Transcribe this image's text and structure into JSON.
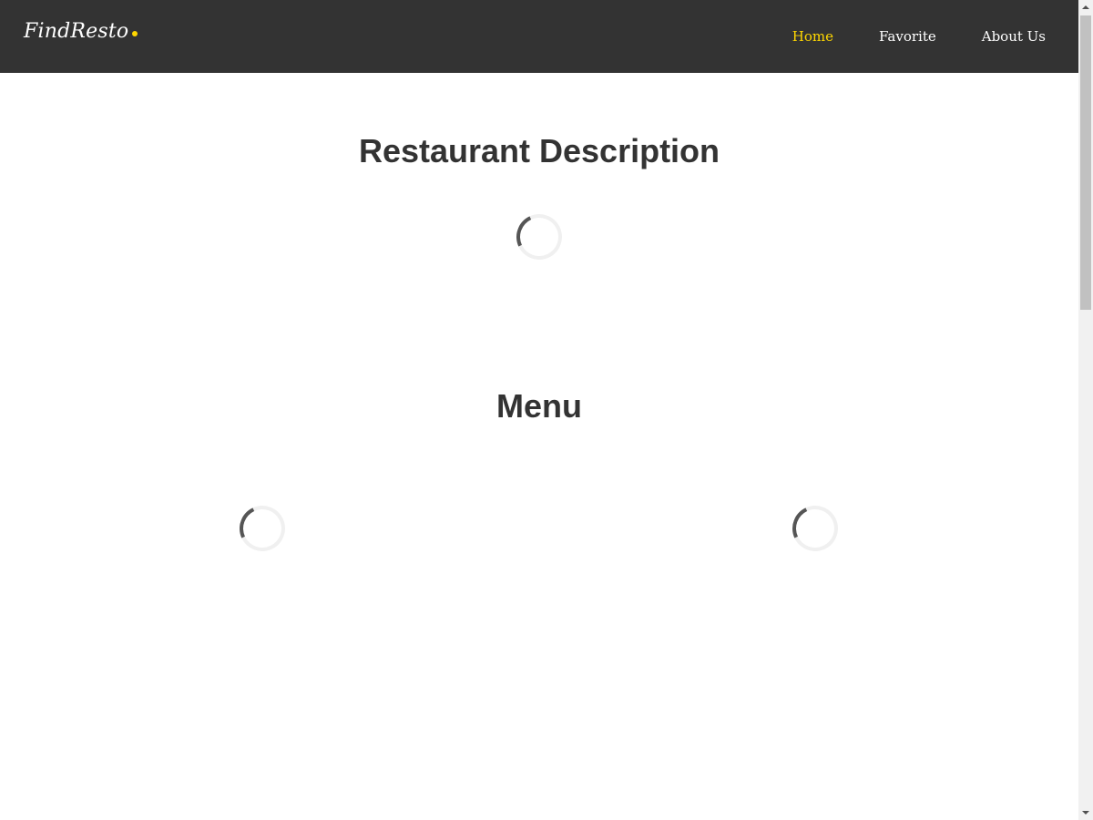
{
  "header": {
    "brand": "FindResto",
    "brand_dot_color": "#ffd700",
    "nav": [
      {
        "label": "Home",
        "active": true
      },
      {
        "label": "Favorite",
        "active": false
      },
      {
        "label": "About Us",
        "active": false
      }
    ],
    "background_color": "#333333",
    "active_color": "#ffd700"
  },
  "main": {
    "description_title": "Restaurant Description",
    "menu_title": "Menu",
    "loading_indicators": [
      {
        "section": "description",
        "state": "loading"
      },
      {
        "section": "menu-foods",
        "state": "loading"
      },
      {
        "section": "menu-drinks",
        "state": "loading"
      }
    ]
  },
  "icons": {
    "spinner": "loading-spinner-icon",
    "scroll_up": "chevron-up-icon",
    "scroll_down": "chevron-down-icon"
  }
}
